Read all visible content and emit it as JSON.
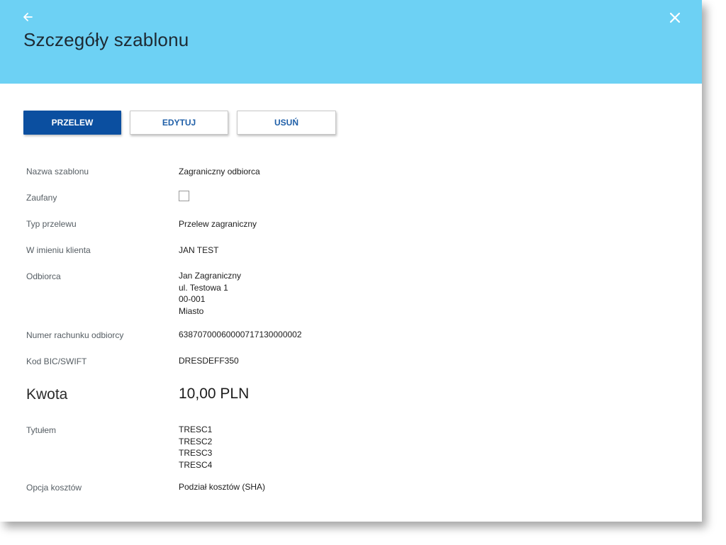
{
  "header": {
    "title": "Szczegóły szablonu",
    "bg_color": "#6dd1f4",
    "back_icon": "arrow-left-icon",
    "close_icon": "close-icon"
  },
  "actions": {
    "transfer": "PRZELEW",
    "edit": "EDYTUJ",
    "delete": "USUŃ",
    "primary_color": "#0b4fa0"
  },
  "details": {
    "template_name": {
      "label": "Nazwa szablonu",
      "value": "Zagraniczny odbiorca"
    },
    "trusted": {
      "label": "Zaufany",
      "checked": false
    },
    "transfer_type": {
      "label": "Typ przelewu",
      "value": "Przelew zagraniczny"
    },
    "client": {
      "label": "W imieniu klienta",
      "value": "JAN TEST"
    },
    "recipient": {
      "label": "Odbiorca",
      "lines": [
        "Jan Zagraniczny",
        "ul. Testowa 1",
        "00-001",
        "Miasto"
      ]
    },
    "account": {
      "label": "Numer rachunku odbiorcy",
      "value": "63870700060000717130000002"
    },
    "bic": {
      "label": "Kod BIC/SWIFT",
      "value": "DRESDEFF350"
    },
    "amount": {
      "label": "Kwota",
      "value": "10,00 PLN"
    },
    "title": {
      "label": "Tytułem",
      "lines": [
        "TRESC1",
        "TRESC2",
        "TRESC3",
        "TRESC4"
      ]
    },
    "costs": {
      "label": "Opcja kosztów",
      "value": "Podział kosztów (SHA)"
    }
  }
}
